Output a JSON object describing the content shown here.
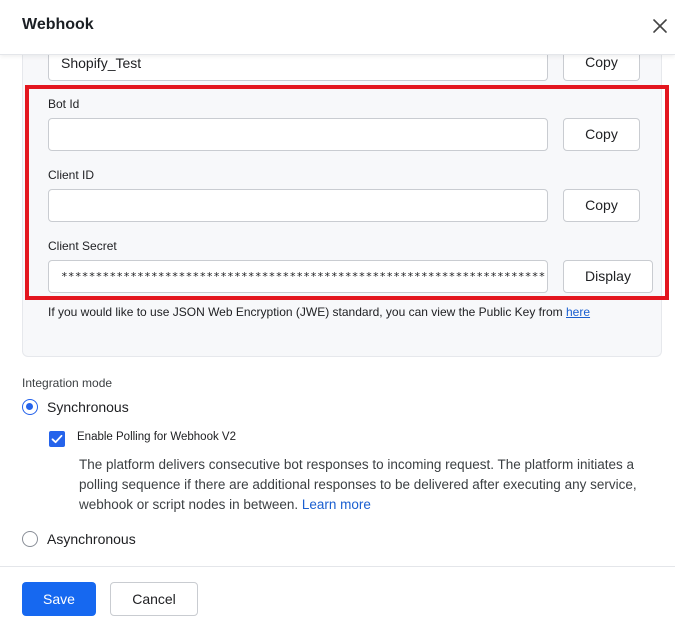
{
  "dialog": {
    "title": "Webhook"
  },
  "credentials": {
    "app_name_value": "Shopify_Test",
    "copy_label": "Copy",
    "bot_id": {
      "label": "Bot Id",
      "value": "",
      "copy_label": "Copy"
    },
    "client_id": {
      "label": "Client ID",
      "value": "",
      "copy_label": "Copy"
    },
    "client_secret": {
      "label": "Client Secret",
      "value": "**********************************************************************",
      "display_label": "Display"
    },
    "jwe_note": "If you would like to use JSON Web Encryption (JWE) standard, you can view the Public Key from ",
    "jwe_link": "here"
  },
  "integration": {
    "label": "Integration mode",
    "synchronous": {
      "label": "Synchronous",
      "selected": true
    },
    "polling": {
      "label": "Enable Polling for Webhook V2",
      "checked": true,
      "description": "The platform delivers consecutive bot responses to incoming request. The platform initiates a polling sequence if there are additional responses to be delivered after executing any service, webhook or script nodes in between. ",
      "learn_more": "Learn more"
    },
    "asynchronous": {
      "label": "Asynchronous",
      "selected": false
    }
  },
  "footer": {
    "save_label": "Save",
    "cancel_label": "Cancel"
  },
  "colors": {
    "primary": "#1668f0",
    "highlight_border": "#e3161f",
    "link": "#1a5fd0"
  }
}
